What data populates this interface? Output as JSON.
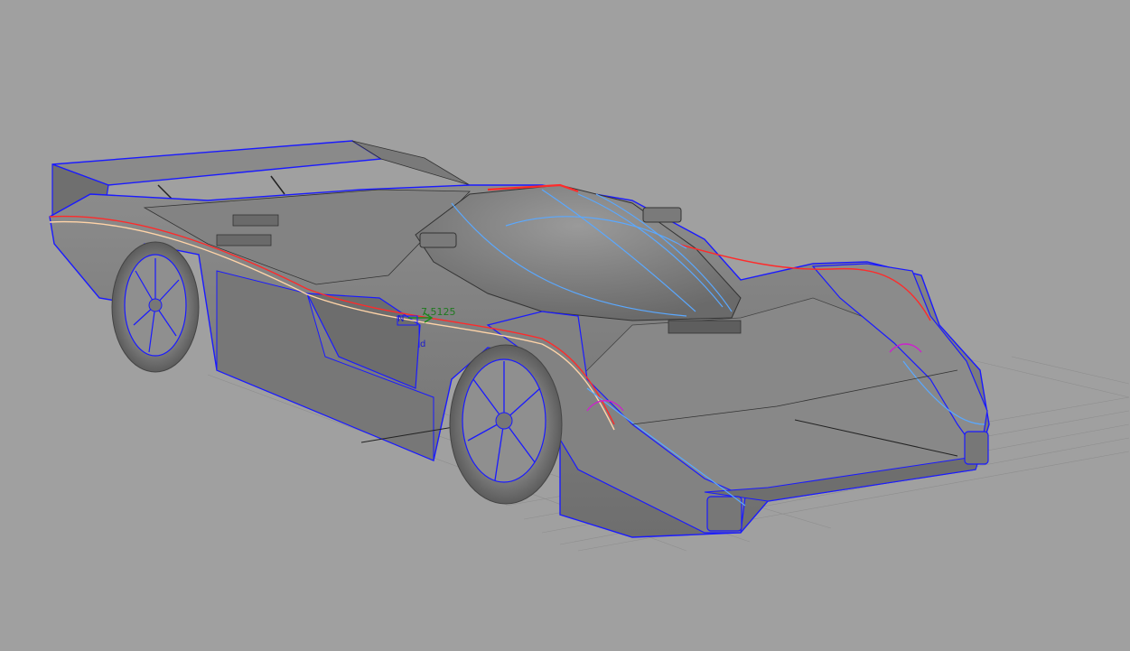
{
  "viewport": {
    "background": "#a0a0a0",
    "dimension_readout": "7.5125",
    "gumball_markers": {
      "normal": "N",
      "direction": "d"
    }
  },
  "colors": {
    "body_shade": "#7d7d7d",
    "edge_blue": "#1a1aff",
    "isocurve_light_blue": "#5aa8ff",
    "highlight_red": "#ff2a2a",
    "grid": "#8f8f8f",
    "magenta_curve": "#cc22cc"
  }
}
